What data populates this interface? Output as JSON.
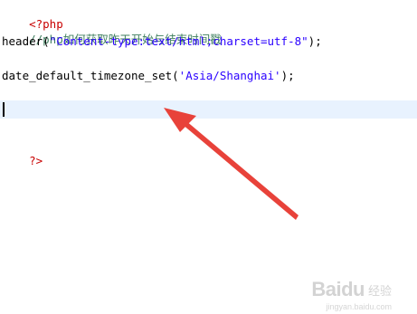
{
  "editor": {
    "lines": {
      "php_open": "<?php",
      "comment": "//php如何获取昨天开始与结束时间戳",
      "header_fn": "header(",
      "header_str": "\"Content-type:text/html;charset=utf-8\"",
      "header_end": ");",
      "tz_fn": "date_default_timezone_set(",
      "tz_str": "'Asia/Shanghai'",
      "tz_end": ");",
      "php_close": "?>"
    },
    "colors": {
      "php_tag": "#c80000",
      "comment": "#3f7f5f",
      "string": "#2a00ff",
      "current_line_highlight": "#e8f2fe",
      "annotation_arrow": "#e8423a"
    }
  },
  "watermark": {
    "brand": "Baidu",
    "sub": "经验",
    "url": "jingyan.baidu.com"
  }
}
